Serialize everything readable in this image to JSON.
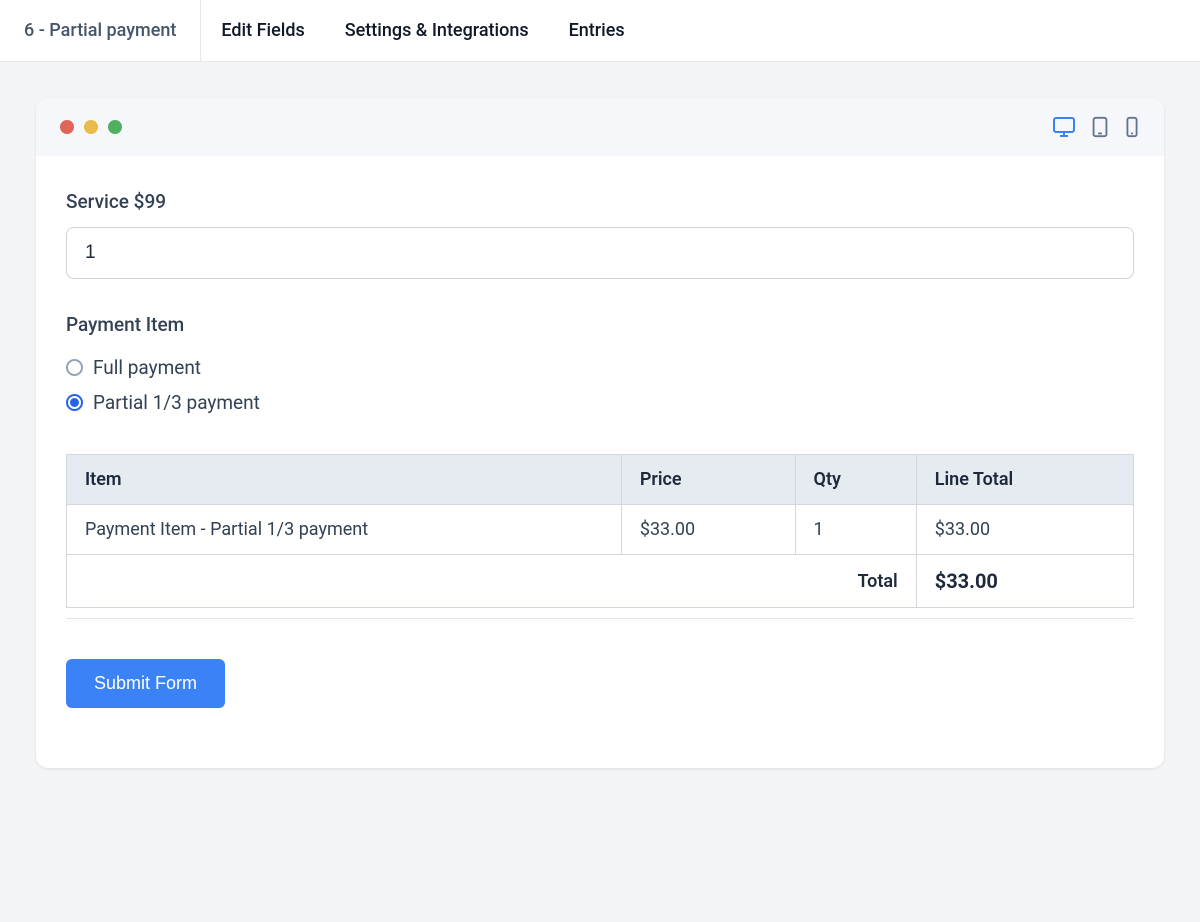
{
  "topbar": {
    "page_name": "6 - Partial payment",
    "tabs": [
      "Edit Fields",
      "Settings & Integrations",
      "Entries"
    ]
  },
  "form": {
    "service_label": "Service $99",
    "service_value": "1",
    "payment_item_label": "Payment Item",
    "options": [
      {
        "label": "Full payment",
        "selected": false
      },
      {
        "label": "Partial 1/3 payment",
        "selected": true
      }
    ],
    "table": {
      "headers": [
        "Item",
        "Price",
        "Qty",
        "Line Total"
      ],
      "rows": [
        {
          "item": "Payment Item - Partial 1/3 payment",
          "price": "$33.00",
          "qty": "1",
          "line_total": "$33.00"
        }
      ],
      "total_label": "Total",
      "total_value": "$33.00"
    },
    "submit_label": "Submit Form"
  },
  "icons": {
    "desktop": "desktop-icon",
    "tablet": "tablet-icon",
    "mobile": "mobile-icon"
  }
}
